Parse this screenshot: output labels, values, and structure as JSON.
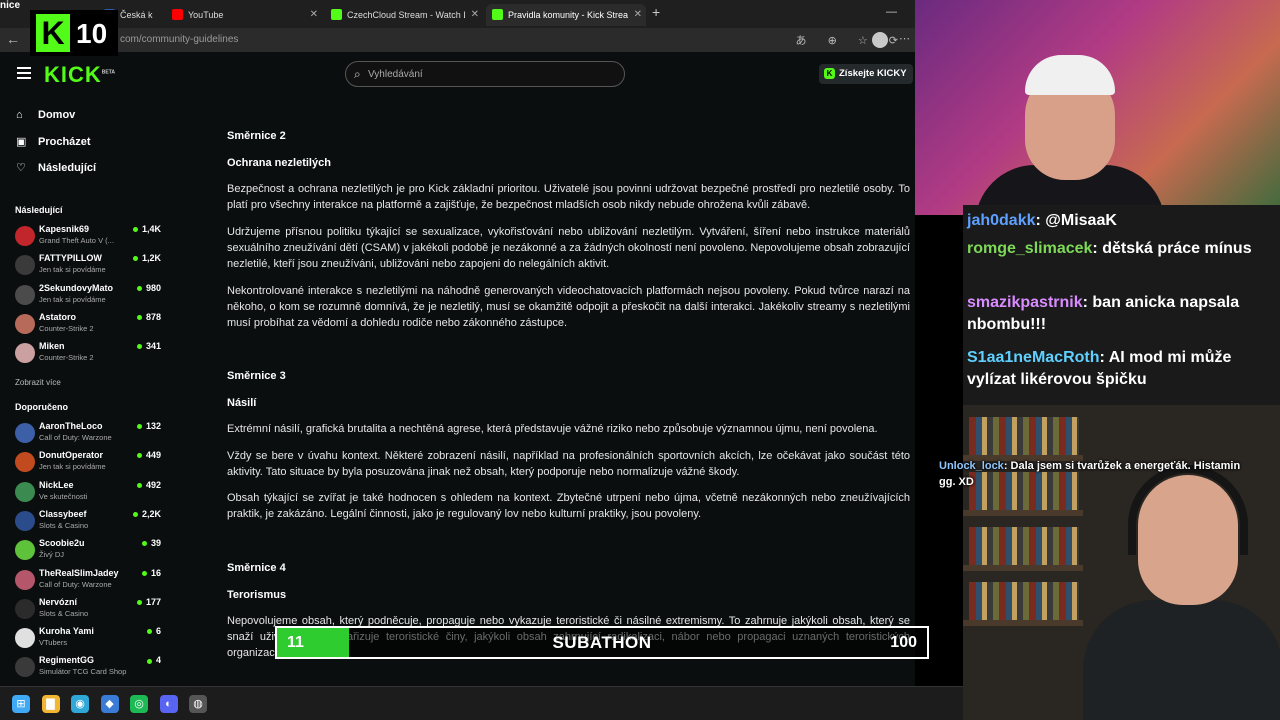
{
  "overlay": {
    "corner_text": "nice",
    "kick_letter": "K",
    "kick_count": "10"
  },
  "browser": {
    "tabs": [
      {
        "label": "Česká k",
        "favicon_color": "#2a5db0"
      },
      {
        "label": "YouTube",
        "favicon_color": "#ff0000"
      },
      {
        "label": "CzechCloud Stream - Watch Live o",
        "favicon_color": "#53fc18"
      },
      {
        "label": "Pravidla komunity - Kick Streaming",
        "favicon_color": "#53fc18"
      }
    ],
    "new_tab": "+",
    "url": "com/community-guidelines"
  },
  "kick": {
    "logo": "KICK",
    "logo_badge": "BETA",
    "search_placeholder": "Vyhledávání",
    "kicky_button": "Získejte KICKY",
    "brand_color": "#53fc18"
  },
  "sidebar": {
    "nav": [
      {
        "label": "Domov",
        "icon": "home-icon"
      },
      {
        "label": "Procházet",
        "icon": "browse-icon"
      },
      {
        "label": "Následující",
        "icon": "heart-icon"
      }
    ],
    "following_title": "Následující",
    "following": [
      {
        "name": "Kapesnik69",
        "game": "Grand Theft Auto V (...",
        "viewers": "1,4K",
        "color": "#c0262b"
      },
      {
        "name": "FATTYPILLOW",
        "game": "Jen tak si povídáme",
        "viewers": "1,2K",
        "color": "#3a3a3a"
      },
      {
        "name": "2SekundovyMato",
        "game": "Jen tak si povídáme",
        "viewers": "980",
        "color": "#4b4b4b"
      },
      {
        "name": "Astatoro",
        "game": "Counter-Strike 2",
        "viewers": "878",
        "color": "#b86a5a"
      },
      {
        "name": "Miken",
        "game": "Counter-Strike 2",
        "viewers": "341",
        "color": "#caa0a0"
      }
    ],
    "show_more": "Zobrazit více",
    "recommended_title": "Doporučeno",
    "recommended": [
      {
        "name": "AaronTheLoco",
        "game": "Call of Duty: Warzone",
        "viewers": "132",
        "color": "#3d5fa8"
      },
      {
        "name": "DonutOperator",
        "game": "Jen tak si povídáme",
        "viewers": "449",
        "color": "#c24a1f"
      },
      {
        "name": "NickLee",
        "game": "Ve skutečnosti",
        "viewers": "492",
        "color": "#3b8a4f"
      },
      {
        "name": "Classybeef",
        "game": "Slots & Casino",
        "viewers": "2,2K",
        "color": "#2b4c8a"
      },
      {
        "name": "Scoobie2u",
        "game": "Živý DJ",
        "viewers": "39",
        "color": "#5ec23a"
      },
      {
        "name": "TheRealSlimJadey",
        "game": "Call of Duty: Warzone",
        "viewers": "16",
        "color": "#b5566a"
      },
      {
        "name": "Nervózní",
        "game": "Slots & Casino",
        "viewers": "177",
        "color": "#2b2b2b"
      },
      {
        "name": "Kuroha Yami",
        "game": "VTubers",
        "viewers": "6",
        "color": "#e0e0e0"
      },
      {
        "name": "RegimentGG",
        "game": "Simulátor TCG Card Shop",
        "viewers": "4",
        "color": "#3a3a3a"
      }
    ]
  },
  "content": {
    "s2_title": "Směrnice 2",
    "s2_sub": "Ochrana nezletilých",
    "s2_p1": "Bezpečnost a ochrana nezletilých je pro Kick základní prioritou. Uživatelé jsou povinni udržovat bezpečné prostředí pro nezletilé osoby. To platí pro všechny interakce na platformě a zajišťuje, že bezpečnost mladších osob nikdy nebude ohrožena kvůli zábavě.",
    "s2_p2": "Udržujeme přísnou politiku týkající se sexualizace, vykořisťování nebo ubližování nezletilým. Vytváření, šíření nebo instrukce materiálů sexuálního zneužívání dětí (CSAM) v jakékoli podobě je nezákonné a za žádných okolností není povoleno. Nepovolujeme obsah zobrazující nezletilé, kteří jsou zneužíváni, ubližováni nebo zapojeni do nelegálních aktivit.",
    "s2_p3": "Nekontrolované interakce s nezletilými na náhodně generovaných videochatovacích platformách nejsou povoleny. Pokud tvůrce narazí na někoho, o kom se rozumně domnívá, že je nezletilý, musí se okamžitě odpojit a přeskočit na další interakci. Jakékoliv streamy s nezletilými musí probíhat za vědomí a dohledu rodiče nebo zákonného zástupce.",
    "s3_title": "Směrnice 3",
    "s3_sub": "Násilí",
    "s3_p1": "Extrémní násilí, grafická brutalita a nechtěná agrese, která představuje vážné riziko nebo způsobuje významnou újmu, není povolena.",
    "s3_p2": "Vždy se bere v úvahu kontext. Některé zobrazení násilí, například na profesionálních sportovních akcích, lze očekávat jako součást této aktivity. Tato situace by byla posuzována jinak než obsah, který podporuje nebo normalizuje vážné škody.",
    "s3_p3": "Obsah týkající se zvířat je také hodnocen s ohledem na kontext. Zbytečné utrpení nebo újma, včetně nezákonných nebo zneužívajících praktik, je zakázáno. Legální činnosti, jako je regulovaný lov nebo kulturní praktiky, jsou povoleny.",
    "s4_title": "Směrnice 4",
    "s4_sub": "Terorismus",
    "s4_p1": "Nepovolujeme obsah, který podněcuje, propaguje nebo vykazuje teroristické či násilné extremismy. To zahrnuje jakýkoli obsah, který se snaží uživatele nebo nařizuje teroristické činy, jakýkoli obsah zahrnující radikalizaci, nábor nebo propagaci uznaných teroristických organizací."
  },
  "subathon": {
    "left_value": "11",
    "title": "SUBATHON",
    "right_value": "100",
    "progress": 0.11,
    "fill_color": "#2ecc2e"
  },
  "chat": {
    "messages": [
      {
        "user": "jah0dakk",
        "text": "@MisaaK",
        "color": "#5ea0ff"
      },
      {
        "user": "romge_slimacek",
        "text": "dětská práce mínus",
        "color": "#7ed957"
      },
      {
        "user": "smazikpastrnik",
        "text": "ban anicka napsala nbombu!!!",
        "color": "#d98cff"
      },
      {
        "user": "S1aa1neMacRoth",
        "text": "AI mod mi může vylízat likérovou špičku",
        "color": "#5fd0ff"
      }
    ],
    "overlay_message": {
      "user": "Unlock_lock",
      "text": "Dala jsem si tvarůžek a energeťák. Histamin gg. XD",
      "color": "#8fc6ff"
    }
  },
  "taskbar": {
    "icons": [
      {
        "name": "windows-icon",
        "glyph": "⊞",
        "color": "#3fa9f5"
      },
      {
        "name": "file-explorer-icon",
        "glyph": "▇",
        "color": "#f2b632"
      },
      {
        "name": "edge-icon",
        "glyph": "◉",
        "color": "#2fa8d8"
      },
      {
        "name": "app-icon",
        "glyph": "◆",
        "color": "#3a7bd5"
      },
      {
        "name": "spotify-icon",
        "glyph": "◎",
        "color": "#1db954"
      },
      {
        "name": "discord-icon",
        "glyph": "◐",
        "color": "#5865f2"
      },
      {
        "name": "obs-icon",
        "glyph": "◍",
        "color": "#555555"
      }
    ]
  }
}
